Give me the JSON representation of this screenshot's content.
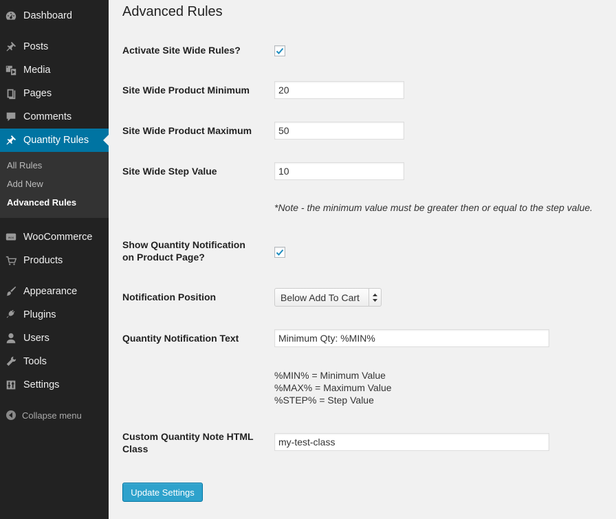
{
  "sidebar": {
    "menu": [
      {
        "label": "Dashboard",
        "icon": "dashboard-icon"
      },
      {
        "label": "Posts",
        "icon": "pin-icon"
      },
      {
        "label": "Media",
        "icon": "media-icon"
      },
      {
        "label": "Pages",
        "icon": "pages-icon"
      },
      {
        "label": "Comments",
        "icon": "comment-icon"
      },
      {
        "label": "Quantity Rules",
        "icon": "pin-icon"
      },
      {
        "label": "WooCommerce",
        "icon": "woo-icon"
      },
      {
        "label": "Products",
        "icon": "cart-icon"
      },
      {
        "label": "Appearance",
        "icon": "brush-icon"
      },
      {
        "label": "Plugins",
        "icon": "plug-icon"
      },
      {
        "label": "Users",
        "icon": "user-icon"
      },
      {
        "label": "Tools",
        "icon": "wrench-icon"
      },
      {
        "label": "Settings",
        "icon": "settings-icon"
      }
    ],
    "submenu": [
      {
        "label": "All Rules"
      },
      {
        "label": "Add New"
      },
      {
        "label": "Advanced Rules"
      }
    ],
    "collapse_label": "Collapse menu"
  },
  "main": {
    "title": "Advanced Rules",
    "activate_label": "Activate Site Wide Rules?",
    "activate_checked": true,
    "min_label": "Site Wide Product Minimum",
    "min_value": "20",
    "max_label": "Site Wide Product Maximum",
    "max_value": "50",
    "step_label": "Site Wide Step Value",
    "step_value": "10",
    "note": "*Note - the minimum value must be greater then or equal to the step value.",
    "show_notif_label_1": "Show Quantity Notification",
    "show_notif_label_2": "on Product Page?",
    "show_notif_checked": true,
    "position_label": "Notification Position",
    "position_value": "Below Add To Cart",
    "notif_text_label": "Quantity Notification Text",
    "notif_text_value": "Minimum Qty: %MIN%",
    "legend": [
      "%MIN% = Minimum Value",
      "%MAX% = Maximum Value",
      "%STEP% = Step Value"
    ],
    "class_label_1": "Custom Quantity Note HTML",
    "class_label_2": "Class",
    "class_value": "my-test-class",
    "submit_label": "Update Settings"
  },
  "colors": {
    "sidebar_bg": "#222222",
    "active_bg": "#0074a2",
    "button_bg": "#2ea2cc",
    "page_bg": "#f1f1f1"
  }
}
